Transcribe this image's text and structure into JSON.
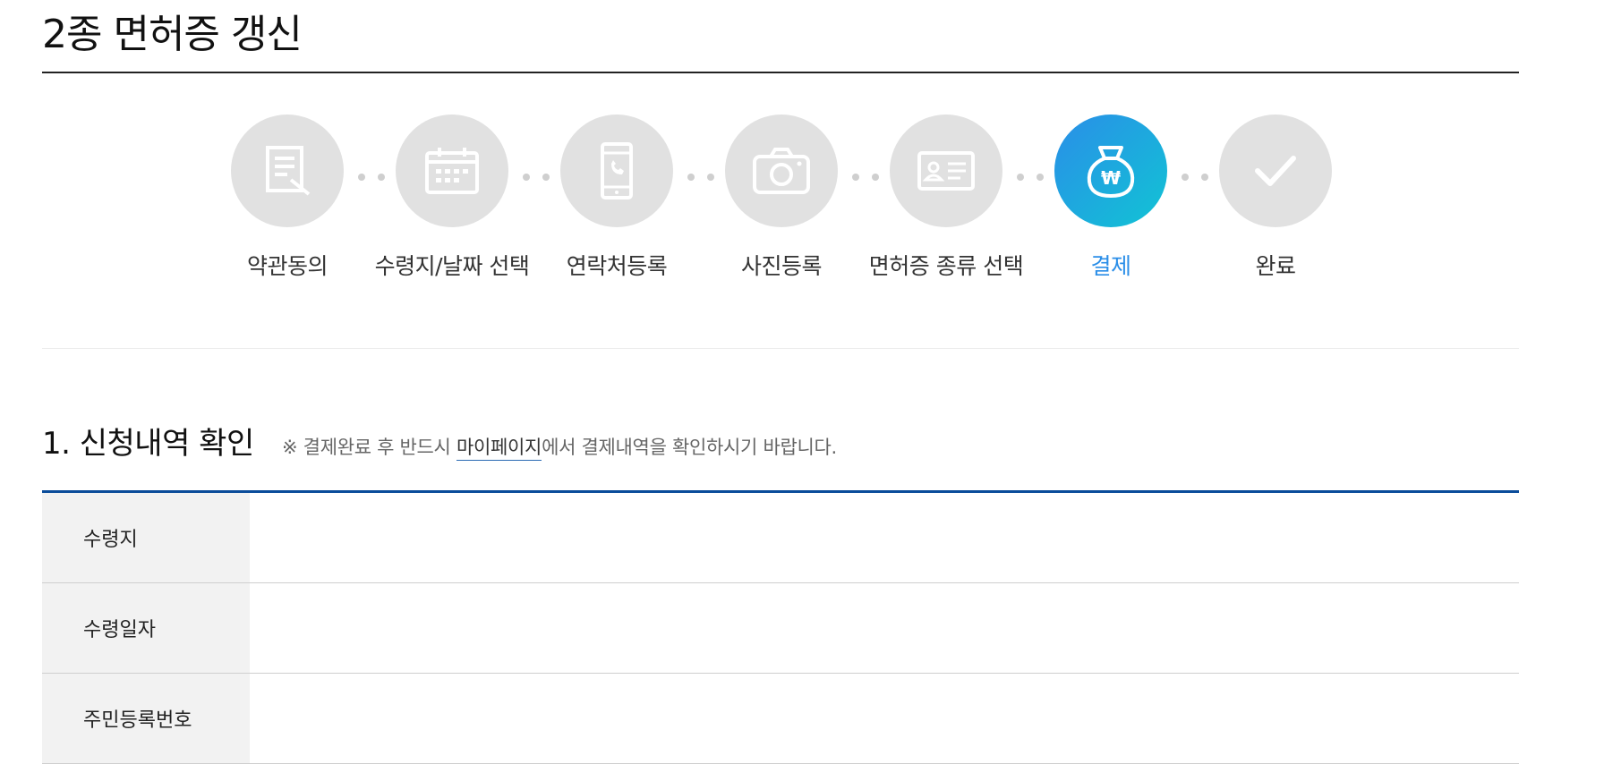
{
  "page": {
    "title": "2종 면허증 갱신"
  },
  "stepper": {
    "steps": [
      {
        "label": "약관동의",
        "icon": "document-pen-icon",
        "active": false
      },
      {
        "label": "수령지/날짜 선택",
        "icon": "calendar-icon",
        "active": false
      },
      {
        "label": "연락처등록",
        "icon": "phone-icon",
        "active": false
      },
      {
        "label": "사진등록",
        "icon": "camera-icon",
        "active": false
      },
      {
        "label": "면허증 종류 선택",
        "icon": "id-card-icon",
        "active": false
      },
      {
        "label": "결제",
        "icon": "won-pouch-icon",
        "active": true
      },
      {
        "label": "완료",
        "icon": "check-icon",
        "active": false
      }
    ],
    "colors": {
      "inactive": "#e1e1e1",
      "active_start": "#2a8ee8",
      "active_end": "#11c4d4",
      "active_label": "#2a8ee8"
    }
  },
  "section": {
    "title": "1. 신청내역 확인",
    "note_prefix": "※ 결제완료 후 반드시 ",
    "note_link": "마이페이지",
    "note_suffix": "에서 결제내역을 확인하시기 바랍니다.",
    "table": {
      "rows": [
        {
          "header": "수령지",
          "value": ""
        },
        {
          "header": "수령일자",
          "value": ""
        },
        {
          "header": "주민등록번호",
          "value": ""
        }
      ]
    }
  }
}
